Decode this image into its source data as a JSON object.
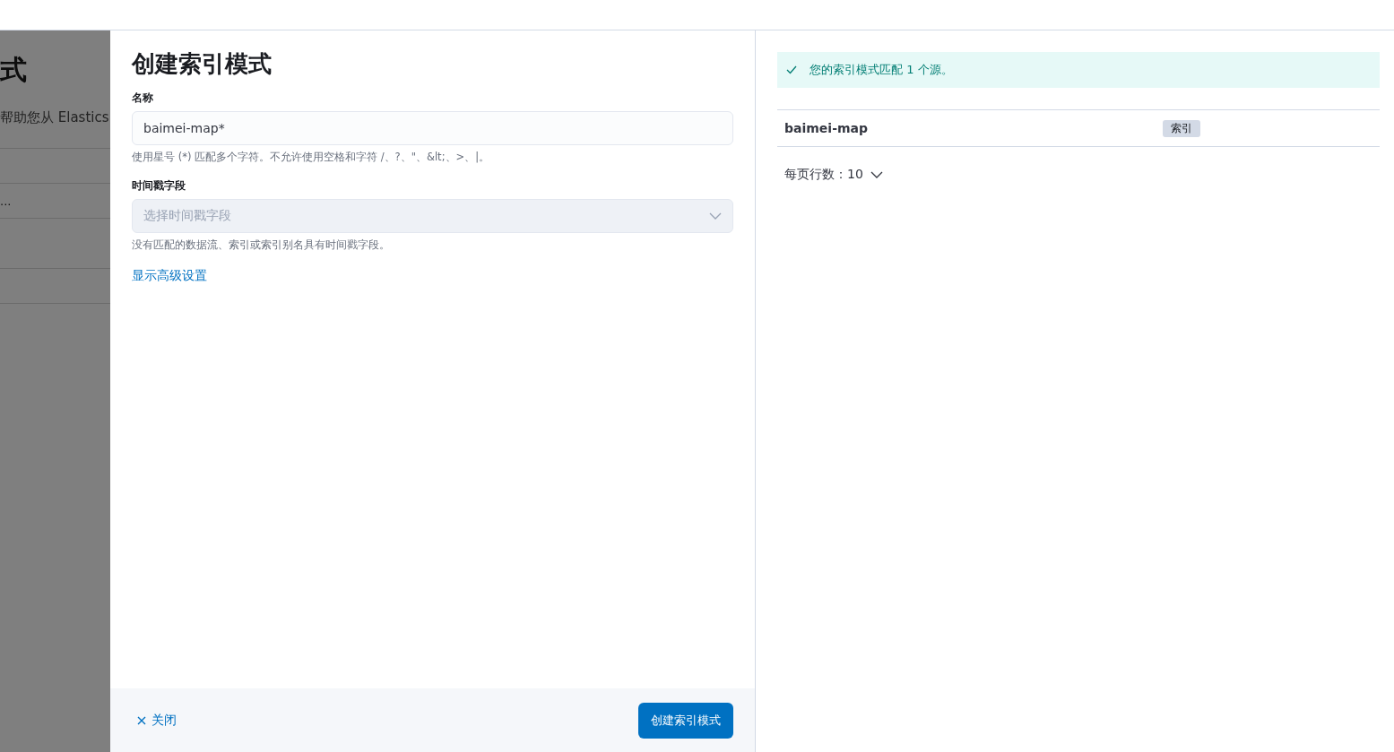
{
  "background_page": {
    "title": "式",
    "description": "帮助您从 Elastics",
    "row_text": "..."
  },
  "flyout": {
    "title": "创建索引模式",
    "name_field": {
      "label": "名称",
      "value": "baimei-map*",
      "help": "使用星号 (*) 匹配多个字符。不允许使用空格和字符 /、?、\"、&lt;、>、|。"
    },
    "timestamp_field": {
      "label": "时间戳字段",
      "placeholder": "选择时间戳字段",
      "disabled": true,
      "help": "没有匹配的数据流、索引或索引别名具有时间戳字段。"
    },
    "advanced_link": "显示高级设置",
    "footer": {
      "close": "关闭",
      "submit": "创建索引模式"
    },
    "callout": "您的索引模式匹配 1 个源。",
    "sources": [
      {
        "name": "baimei-map",
        "type": "索引"
      }
    ],
    "rows_per_page": {
      "label": "每页行数：",
      "value": "10"
    }
  }
}
